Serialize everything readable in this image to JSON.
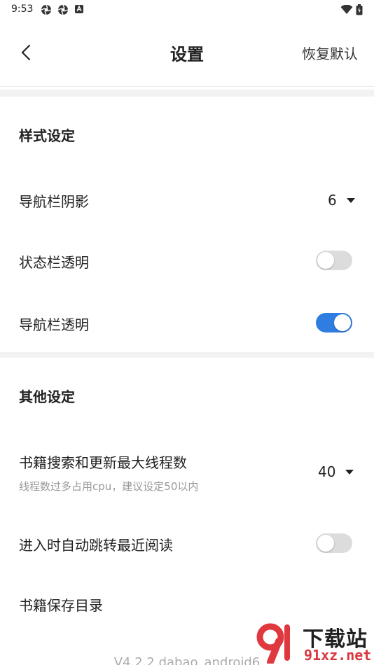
{
  "status_bar": {
    "time": "9:53"
  },
  "app_bar": {
    "title": "设置",
    "reset_label": "恢复默认"
  },
  "sections": [
    {
      "title": "样式设定"
    },
    {
      "title": "其他设定"
    }
  ],
  "settings": {
    "nav_bar_shadow": {
      "label": "导航栏阴影",
      "value": "6"
    },
    "status_bar_transparent": {
      "label": "状态栏透明",
      "checked": false
    },
    "nav_bar_transparent": {
      "label": "导航栏透明",
      "checked": true
    },
    "max_threads": {
      "label": "书籍搜索和更新最大线程数",
      "sublabel": "线程数过多占用cpu，建议设定50以内",
      "value": "40"
    },
    "auto_jump_recent": {
      "label": "进入时自动跳转最近阅读",
      "checked": false
    },
    "book_save_dir": {
      "label": "书籍保存目录"
    }
  },
  "version": "V4.2.2 dabao_android6",
  "watermark": {
    "name": "下载站",
    "url": "91xz.net"
  },
  "colors": {
    "accent": "#2f7de1",
    "toggle_off": "#dcdcdc",
    "divider": "#f2f2f2"
  }
}
